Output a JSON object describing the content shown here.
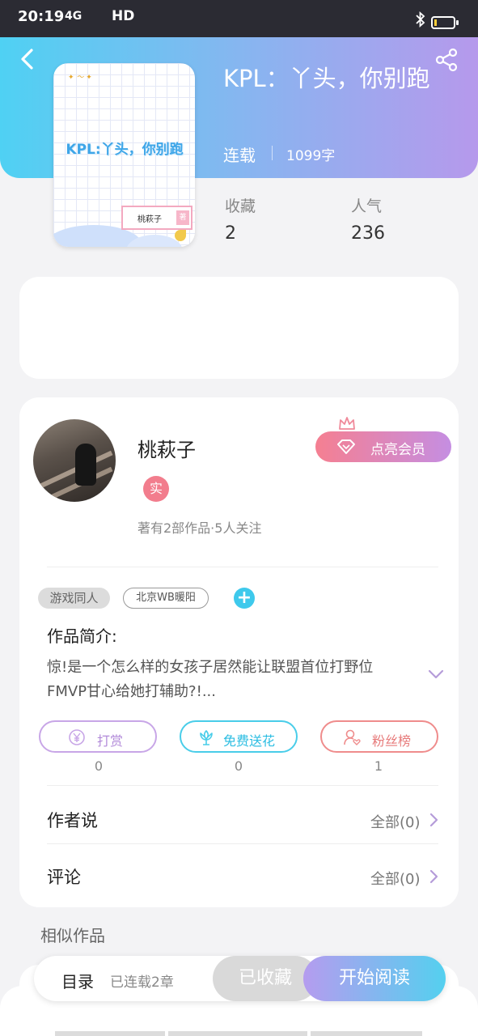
{
  "status_bar": {
    "time": "20:19",
    "network": "4G",
    "hd": "HD",
    "battery_level": 0.15
  },
  "header": {
    "back_icon": "back-arrow-icon",
    "share_icon": "share-icon"
  },
  "cover": {
    "title_art": "KPL:丫头，你别跑",
    "author_art": "桃萩子",
    "seal": "著"
  },
  "book": {
    "title": "KPL：丫头，你别跑",
    "status": "连载",
    "word_count": "1099字"
  },
  "stats": {
    "favorites_label": "收藏",
    "favorites_value": "2",
    "popularity_label": "人气",
    "popularity_value": "236"
  },
  "author": {
    "name": "桃萩子",
    "verified_badge": "实",
    "meta": "著有2部作品·5人关注",
    "vip_button": "点亮会员"
  },
  "tags": {
    "items": [
      "游戏同人",
      "北京WB暖阳"
    ],
    "add": "+"
  },
  "intro": {
    "label": "作品简介:",
    "text": "惊!是一个怎么样的女孩子居然能让联盟首位打野位FMVP甘心给她打辅助?!..."
  },
  "actions": [
    {
      "label": "打赏",
      "count": "0",
      "icon": "yen-coin-icon"
    },
    {
      "label": "免费送花",
      "count": "0",
      "icon": "flower-icon"
    },
    {
      "label": "粉丝榜",
      "count": "1",
      "icon": "user-heart-icon"
    }
  ],
  "rows": {
    "author_says_label": "作者说",
    "author_says_right": "全部(0)",
    "comments_label": "评论",
    "comments_right": "全部(0)"
  },
  "similar": {
    "label": "相似作品"
  },
  "bottom_bar": {
    "toc_label": "目录",
    "chapters": "已连载2章",
    "collected": "已收藏",
    "start_reading": "开始阅读"
  },
  "colors": {
    "header_gradient_start": "#4fd1f3",
    "header_gradient_end": "#b699ec",
    "accent_cyan": "#3ec9ec",
    "accent_pink": "#f27d8d",
    "accent_purple": "#b59cef"
  }
}
